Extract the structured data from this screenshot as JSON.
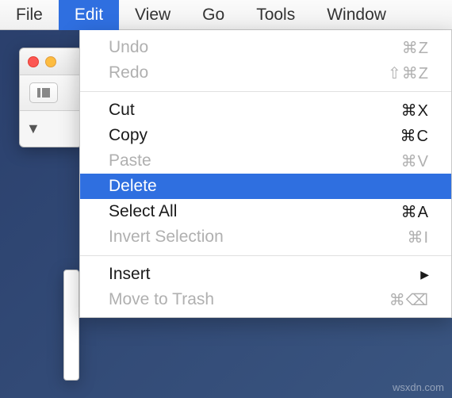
{
  "menubar": {
    "items": [
      {
        "label": "File",
        "active": false
      },
      {
        "label": "Edit",
        "active": true
      },
      {
        "label": "View",
        "active": false
      },
      {
        "label": "Go",
        "active": false
      },
      {
        "label": "Tools",
        "active": false
      },
      {
        "label": "Window",
        "active": false
      }
    ]
  },
  "dropdown": {
    "groups": [
      [
        {
          "label": "Undo",
          "shortcut": "⌘Z",
          "disabled": true
        },
        {
          "label": "Redo",
          "shortcut": "⇧⌘Z",
          "disabled": true
        }
      ],
      [
        {
          "label": "Cut",
          "shortcut": "⌘X",
          "disabled": false
        },
        {
          "label": "Copy",
          "shortcut": "⌘C",
          "disabled": false
        },
        {
          "label": "Paste",
          "shortcut": "⌘V",
          "disabled": true
        },
        {
          "label": "Delete",
          "shortcut": "",
          "disabled": false,
          "highlighted": true
        },
        {
          "label": "Select All",
          "shortcut": "⌘A",
          "disabled": false
        },
        {
          "label": "Invert Selection",
          "shortcut": "⌘I",
          "disabled": true
        }
      ],
      [
        {
          "label": "Insert",
          "shortcut": "",
          "disabled": false,
          "submenu": true
        },
        {
          "label": "Move to Trash",
          "shortcut": "⌘⌫",
          "disabled": true
        }
      ]
    ]
  },
  "watermark": "wsxdn.com"
}
